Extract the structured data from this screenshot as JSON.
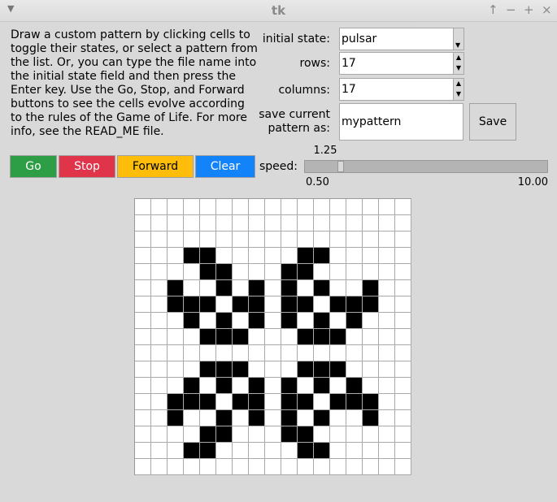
{
  "window": {
    "title": "tk"
  },
  "description": "Draw a custom pattern by clicking cells to toggle their states, or select a pattern from the list. Or, you can type the file name into the initial state field and then press the Enter key. Use the Go, Stop, and Forward buttons to see the cells evolve according to the rules of the Game of Life. For more info, see the READ_ME file.",
  "initial_state": {
    "label": "initial state:",
    "value": "pulsar"
  },
  "rows": {
    "label": "rows:",
    "value": "17"
  },
  "columns": {
    "label": "columns:",
    "value": "17"
  },
  "save": {
    "label_line1": "save current",
    "label_line2": "pattern as:",
    "value": "mypattern",
    "button": "Save"
  },
  "controls": {
    "go": "Go",
    "stop": "Stop",
    "forward": "Forward",
    "clear": "Clear"
  },
  "speed": {
    "label": "speed:",
    "value": "1.25",
    "min": "0.50",
    "max": "10.00",
    "current": 1.25,
    "from": 0.5,
    "to": 10.0
  },
  "colors": {
    "go": "#2e9e46",
    "stop": "#e0344b",
    "forward": "#ffbd0b",
    "clear": "#1283f9",
    "cell_on": "#000000",
    "cell_off": "#ffffff"
  },
  "grid": {
    "rows": 17,
    "cols": 17,
    "cells": [
      "00000000000000000",
      "00000000000000000",
      "00000000000000000",
      "00011000001100000",
      "00001100011000000",
      "00100101010100100",
      "00111011011011100",
      "00010101010101000",
      "00001110001110000",
      "00000000000000000",
      "00001110001110000",
      "00010101010101000",
      "00111011011011100",
      "00100101010100100",
      "00001100011000000",
      "00011000001100000",
      "00000000000000000"
    ]
  }
}
